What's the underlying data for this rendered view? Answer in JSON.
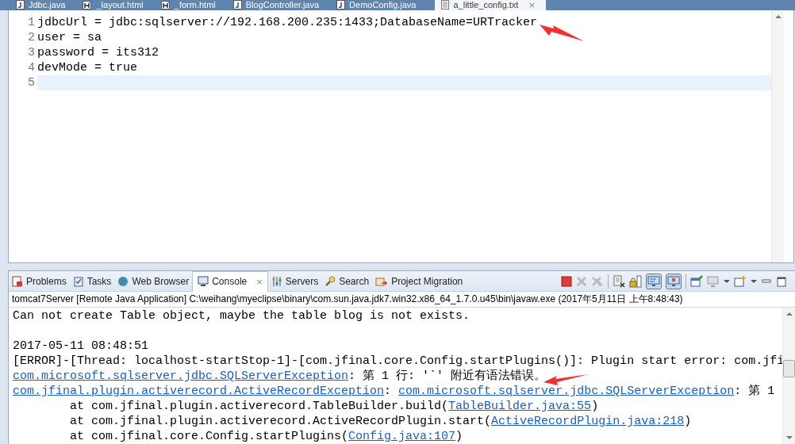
{
  "editor_tabs": [
    {
      "label": "Jdbc.java",
      "kind": "java",
      "selected": false
    },
    {
      "label": "_layout.html",
      "kind": "html",
      "selected": false
    },
    {
      "label": "_form.html",
      "kind": "html",
      "selected": false
    },
    {
      "label": "BlogController.java",
      "kind": "java",
      "selected": false
    },
    {
      "label": "DemoConfig.java",
      "kind": "java",
      "selected": false
    },
    {
      "label": "a_little_config.txt",
      "kind": "text",
      "selected": true,
      "close": "×"
    }
  ],
  "editor": {
    "lines": [
      {
        "number": "1",
        "text": "jdbcUrl = jdbc:sqlserver://192.168.200.235:1433;DatabaseName=URTracker",
        "current": false
      },
      {
        "number": "2",
        "text": "user = sa",
        "current": false
      },
      {
        "number": "3",
        "text": "password = its312",
        "current": false
      },
      {
        "number": "4",
        "text": "devMode = true",
        "current": false
      },
      {
        "number": "5",
        "current": true
      }
    ]
  },
  "panel_tabs": [
    {
      "label": "Problems",
      "kind": "problems",
      "selected": false
    },
    {
      "label": "Tasks",
      "kind": "tasks",
      "selected": false
    },
    {
      "label": "Web Browser",
      "kind": "browser",
      "selected": false
    },
    {
      "label": "Console",
      "kind": "console",
      "selected": true,
      "close": "×"
    },
    {
      "label": "Servers",
      "kind": "servers",
      "selected": false
    },
    {
      "label": "Search",
      "kind": "search",
      "selected": false
    },
    {
      "label": "Project Migration",
      "kind": "migration",
      "selected": false
    }
  ],
  "console": {
    "process": "tomcat7Server [Remote Java Application] C:\\weihang\\myeclipse\\binary\\com.sun.java.jdk7.win32.x86_64_1.7.0.u45\\bin\\javaw.exe (2017年5月11日 上午8:48:43)",
    "lines": [
      {
        "kind": "text",
        "parts": [
          {
            "text": "Can not create Table object, maybe the table blog is not exists.",
            "link": false
          }
        ]
      },
      {
        "kind": "blank"
      },
      {
        "kind": "text",
        "parts": [
          {
            "text": "2017-05-11 08:48:51",
            "link": false
          }
        ]
      },
      {
        "kind": "text",
        "parts": [
          {
            "text": "[ERROR]-[Thread: localhost-startStop-1]-[com.jfinal.core.Config.startPlugins()]: Plugin start error: com.jfi",
            "link": false
          }
        ]
      },
      {
        "kind": "text",
        "parts": [
          {
            "text": "com.microsoft.sqlserver.jdbc.SQLServerException",
            "link": true
          },
          {
            "text": ": 第 1 行: '`' 附近有语法错误。",
            "link": false
          }
        ]
      },
      {
        "kind": "text",
        "parts": [
          {
            "text": "com.jfinal.plugin.activerecord.ActiveRecordException",
            "link": true
          },
          {
            "text": ": ",
            "link": false
          },
          {
            "text": "com.microsoft.sqlserver.jdbc.SQLServerException",
            "link": true
          },
          {
            "text": ": 第 1",
            "link": false
          }
        ]
      },
      {
        "kind": "text",
        "parts": [
          {
            "text": "\tat com.jfinal.plugin.activerecord.TableBuilder.build(",
            "link": false
          },
          {
            "text": "TableBuilder.java:55",
            "link": true
          },
          {
            "text": ")",
            "link": false
          }
        ]
      },
      {
        "kind": "text",
        "parts": [
          {
            "text": "\tat com.jfinal.plugin.activerecord.ActiveRecordPlugin.start(",
            "link": false
          },
          {
            "text": "ActiveRecordPlugin.java:218",
            "link": true
          },
          {
            "text": ")",
            "link": false
          }
        ]
      },
      {
        "kind": "text",
        "parts": [
          {
            "text": "\tat com.jfinal.core.Config.startPlugins(",
            "link": false
          },
          {
            "text": "Config.java:107",
            "link": true
          },
          {
            "text": ")",
            "link": false
          }
        ]
      }
    ]
  }
}
